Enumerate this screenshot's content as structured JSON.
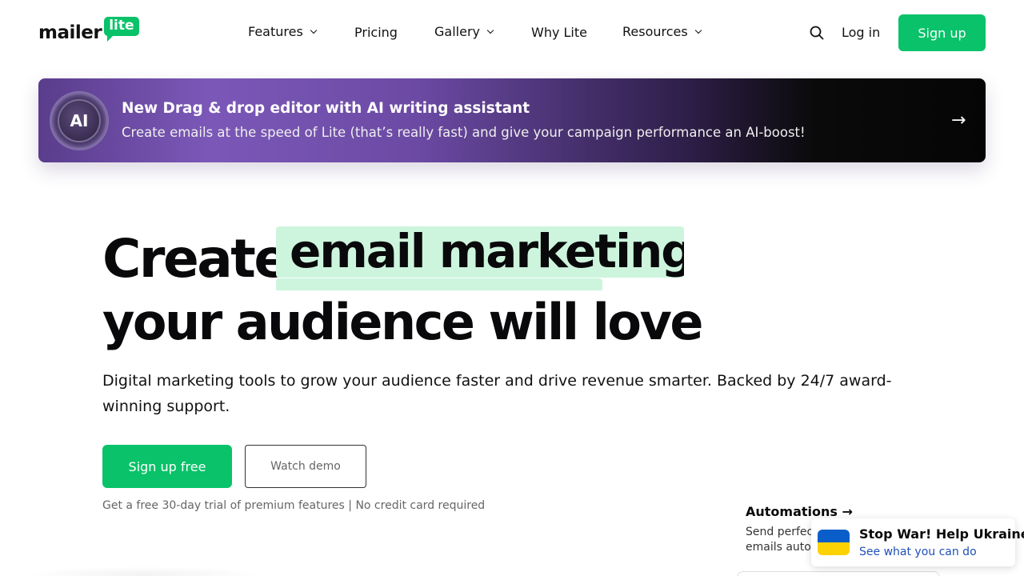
{
  "brand": {
    "logo_left": "mailer",
    "logo_right": "lite",
    "accent": "#09c269"
  },
  "nav": {
    "items": [
      {
        "label": "Features",
        "dropdown": true
      },
      {
        "label": "Pricing",
        "dropdown": false
      },
      {
        "label": "Gallery",
        "dropdown": true
      },
      {
        "label": "Why Lite",
        "dropdown": false
      },
      {
        "label": "Resources",
        "dropdown": true
      }
    ],
    "search_icon": "search-icon",
    "login_label": "Log in",
    "signup_label": "Sign up"
  },
  "banner": {
    "badge_label": "AI",
    "title": "New Drag & drop editor with AI writing assistant",
    "subtitle": "Create emails at the speed of Lite (that’s really fast) and give your campaign performance an AI-boost!",
    "arrow": "→"
  },
  "hero": {
    "line1_prefix": "Create",
    "rotating_word": "email marketing",
    "line2": "your audience will love",
    "description": "Digital marketing tools to grow your audience faster and drive revenue smarter. Backed by 24/7 award-winning support.",
    "primary_cta": "Sign up free",
    "secondary_cta": "Watch demo",
    "note": "Get a free 30-day trial of premium features | No credit card required"
  },
  "feature_card": {
    "title": "Automations →",
    "desc_line1": "Send perfectly timed",
    "desc_line2": "emails automatically"
  },
  "toast": {
    "title": "Stop War! Help Ukraine!",
    "link": "See what you can do",
    "flag_colors": [
      "#0a5ec9",
      "#fcd205"
    ]
  }
}
